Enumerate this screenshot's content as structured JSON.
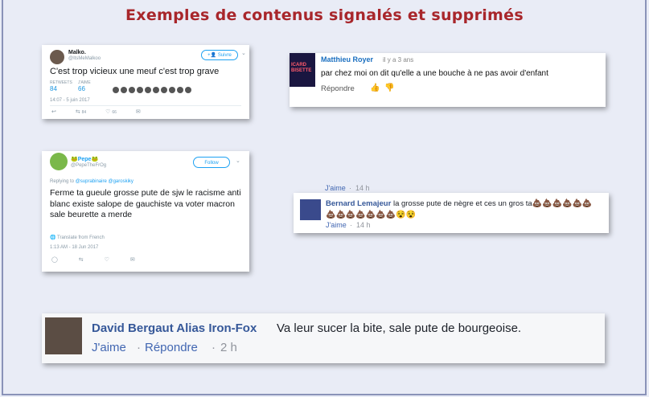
{
  "page": {
    "title": "Exemples de contenus signalés et supprimés"
  },
  "tweet1": {
    "name": "Malko.",
    "handle": "@ItsMeMalkoo",
    "follow_label": "Suivre",
    "text": "C'est trop vicieux une meuf c'est trop grave",
    "retweets_label": "RETWEETS",
    "retweets": "84",
    "likes_label": "J'AIME",
    "likes": "66",
    "date": "14:07 - 5 juin 2017",
    "retweet_count": "84",
    "like_count": "66"
  },
  "youtube": {
    "thumb_text": "ICARD BISETTE",
    "author": "Matthieu Royer",
    "ago": "il y a 3 ans",
    "text": "par chez moi on dit qu'elle a une bouche à ne pas avoir d'enfant",
    "reply": "Répondre",
    "like_icon": "thumbs-up-icon",
    "dislike_icon": "thumbs-down-icon"
  },
  "tweet2": {
    "name": "Pepe",
    "handle": "@PepeTheFrOg",
    "follow_label": "Follow",
    "replying_prefix": "Replying to",
    "replying_to": "@suprabinaire @garoskiky",
    "text": "Ferme ta gueule grosse pute de sjw le racisme anti blanc existe salope de gauchiste va voter macron sale beurette a merde",
    "translate": "Translate from French",
    "date": "1:13 AM - 18 Jun 2017"
  },
  "facebook1": {
    "prev_like": "J'aime",
    "prev_time": "14 h",
    "author": "Bernard Lemajeur",
    "text": "la grosse pute de nègre et ces un gros ta",
    "emojis": "💩💩💩💩💩💩💩💩💩💩💩💩💩😵😵",
    "like": "J'aime",
    "time": "14 h"
  },
  "facebook2": {
    "author": "David Bergaut Alias Iron-Fox",
    "text": "Va leur sucer la bite, sale pute de bourgeoise.",
    "like": "J'aime",
    "reply": "Répondre",
    "time": "2 h"
  },
  "colors": {
    "title": "#a8262b",
    "twitter_blue": "#1da1f2",
    "facebook_blue": "#365899",
    "background": "#e9ecf6"
  }
}
